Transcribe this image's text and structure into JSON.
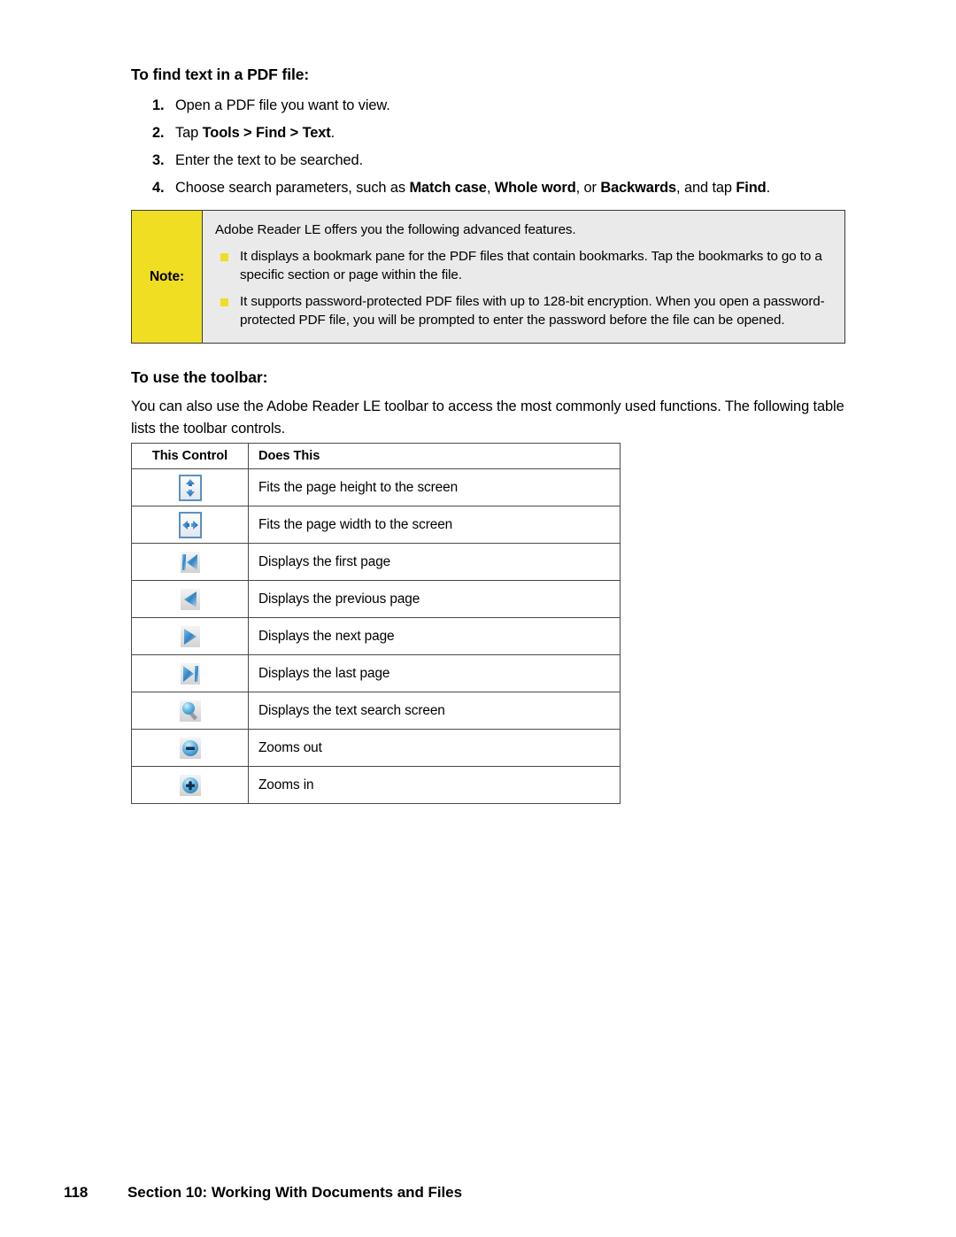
{
  "page": {
    "number": "118",
    "footer_title": "Section 10: Working With Documents and Files"
  },
  "find_section": {
    "heading": "To find text in a PDF file:",
    "steps": [
      {
        "num": "1.",
        "text": "Open a PDF file you want to view."
      },
      {
        "num": "2.",
        "text": "Tap Tools > Find > Text."
      },
      {
        "num": "3.",
        "text": "Enter the text to be searched."
      },
      {
        "num": "4.",
        "text": "Choose search parameters, such as Match case, Whole word, or Backwards, and tap Find."
      }
    ],
    "step2_parts": {
      "lead": "Tap ",
      "b1": "Tools",
      "sep1": " > ",
      "b2": "Find",
      "sep2": " > ",
      "b3": "Text",
      "tail": "."
    },
    "step4_parts": {
      "lead": "Choose search parameters, such as ",
      "b1": "Match case",
      "sep1": ", ",
      "b2": "Whole word",
      "sep2": ", or ",
      "b3": "Backwards",
      "sep3": ", and tap ",
      "b4": "Find",
      "tail": "."
    }
  },
  "note": {
    "label": "Note:",
    "intro": "Adobe Reader LE offers you the following advanced features.",
    "bullets": [
      "It displays a bookmark pane for the PDF files that contain bookmarks. Tap the bookmarks to go to a specific section or page within the file.",
      "It supports password-protected PDF files with up to 128-bit encryption. When you open a password-protected PDF file, you will be prompted to enter the password before the file can be opened."
    ],
    "colors": {
      "label_background": "#f0de23",
      "content_background": "#eaeaea",
      "bullet_square": "#f0de23",
      "border": "#3a3a3a"
    }
  },
  "toolbar_section": {
    "heading": "To use the toolbar:",
    "paragraph": "You can also use the Adobe Reader LE toolbar to access the most commonly used functions. The following table lists the toolbar controls.",
    "table": {
      "headers": [
        "This Control",
        "Does This"
      ],
      "rows": [
        {
          "icon": "fit-page-height-icon",
          "description": "Fits the page height to the screen"
        },
        {
          "icon": "fit-page-width-icon",
          "description": "Fits the page width to the screen"
        },
        {
          "icon": "first-page-icon",
          "description": "Displays the first page"
        },
        {
          "icon": "previous-page-icon",
          "description": "Displays the previous page"
        },
        {
          "icon": "next-page-icon",
          "description": "Displays the next page"
        },
        {
          "icon": "last-page-icon",
          "description": "Displays the last page"
        },
        {
          "icon": "text-search-icon",
          "description": "Displays the text search screen"
        },
        {
          "icon": "zoom-out-icon",
          "description": "Zooms out"
        },
        {
          "icon": "zoom-in-icon",
          "description": "Zooms in"
        }
      ]
    }
  }
}
